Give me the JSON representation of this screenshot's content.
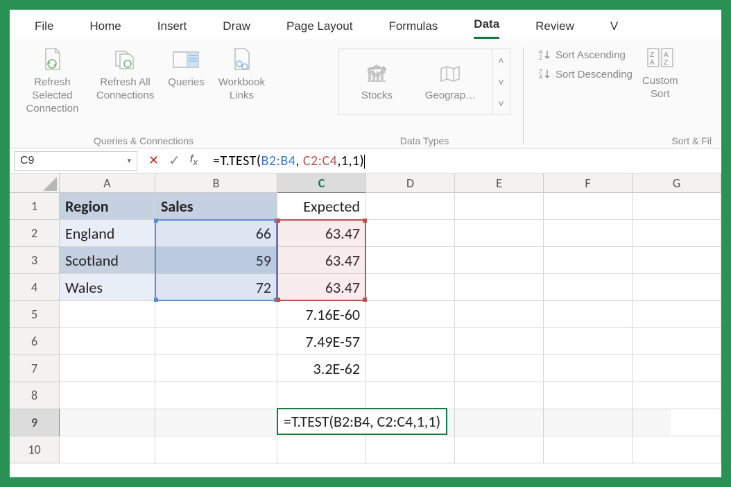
{
  "tabs": [
    "File",
    "Home",
    "Insert",
    "Draw",
    "Page Layout",
    "Formulas",
    "Data",
    "Review",
    "V"
  ],
  "activeTab": "Data",
  "ribbon": {
    "refreshSelected": "Refresh Selected\nConnection",
    "refreshAll": "Refresh All\nConnections",
    "queries": "Queries",
    "workbookLinks": "Workbook\nLinks",
    "groupQC": "Queries & Connections",
    "stocks": "Stocks",
    "geography": "Geograp…",
    "groupDT": "Data Types",
    "sortAsc": "Sort Ascending",
    "sortDesc": "Sort Descending",
    "customSort": "Custom\nSort",
    "groupSort": "Sort & Fil"
  },
  "namebox": "C9",
  "formula": {
    "prefix": "=T.TEST(",
    "range1": "B2:B4",
    "mid": ", ",
    "range2": "C2:C4",
    "suffix": ",1,1)"
  },
  "columns": [
    "A",
    "B",
    "C",
    "D",
    "E",
    "F",
    "G"
  ],
  "rows": [
    "1",
    "2",
    "3",
    "4",
    "5",
    "6",
    "7",
    "8",
    "9",
    "10"
  ],
  "data": {
    "A1": "Region",
    "B1": "Sales",
    "C1": "Expected",
    "A2": "England",
    "B2": "66",
    "C2": "63.47",
    "A3": "Scotland",
    "B3": "59",
    "C3": "63.47",
    "A4": "Wales",
    "B4": "72",
    "C4": "63.47",
    "C5": "7.16E-60",
    "C6": "7.49E-57",
    "C7": "3.2E-62",
    "C9": "=T.TEST(B2:B4, C2:C4,1,1)"
  },
  "chart_data": {
    "type": "table",
    "title": "",
    "columns": [
      "Region",
      "Sales",
      "Expected"
    ],
    "rows": [
      [
        "England",
        66,
        63.47
      ],
      [
        "Scotland",
        59,
        63.47
      ],
      [
        "Wales",
        72,
        63.47
      ]
    ],
    "extra_values_C": {
      "C5": 7.16e-60,
      "C6": 7.49e-57,
      "C7": 3.2e-62
    },
    "active_formula": "=T.TEST(B2:B4, C2:C4,1,1)"
  }
}
